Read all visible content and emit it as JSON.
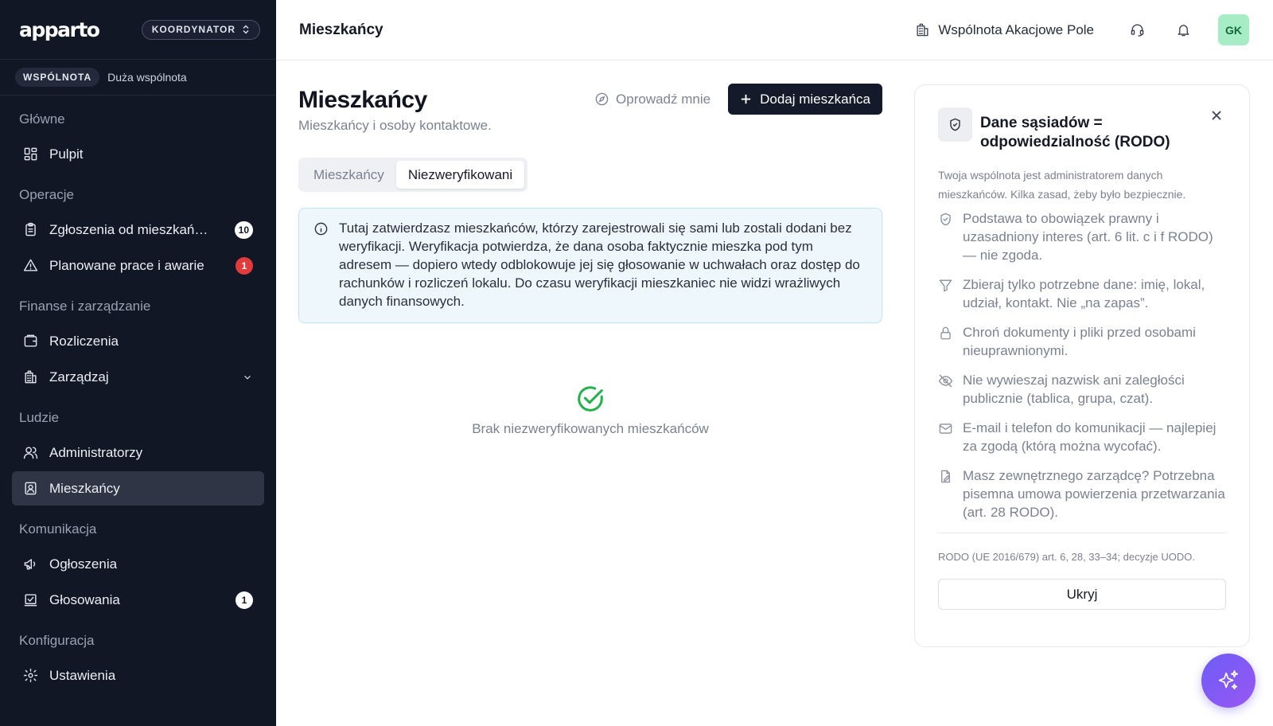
{
  "app": {
    "logo": "apparto",
    "role": "KOORDYNATOR",
    "community_badge": "WSPÓLNOTA",
    "community_size": "Duża wspólnota"
  },
  "sidebar": {
    "sections": [
      {
        "title": "Główne",
        "items": [
          {
            "label": "Pulpit",
            "icon": "dashboard-icon"
          }
        ]
      },
      {
        "title": "Operacje",
        "items": [
          {
            "label": "Zgłoszenia od mieszkań…",
            "icon": "clipboard-icon",
            "badge": "10"
          },
          {
            "label": "Planowane prace i awarie",
            "icon": "warning-icon",
            "badge": "1"
          }
        ]
      },
      {
        "title": "Finanse i zarządzanie",
        "items": [
          {
            "label": "Rozliczenia",
            "icon": "wallet-icon"
          },
          {
            "label": "Zarządzaj",
            "icon": "building-icon"
          }
        ]
      },
      {
        "title": "Ludzie",
        "items": [
          {
            "label": "Administratorzy",
            "icon": "users-icon"
          },
          {
            "label": "Mieszkańcy",
            "icon": "contact-icon"
          }
        ]
      },
      {
        "title": "Komunikacja",
        "items": [
          {
            "label": "Ogłoszenia",
            "icon": "megaphone-icon"
          },
          {
            "label": "Głosowania",
            "icon": "vote-icon",
            "badge": "1"
          }
        ]
      },
      {
        "title": "Konfiguracja",
        "items": [
          {
            "label": "Ustawienia",
            "icon": "gear-icon"
          }
        ]
      }
    ]
  },
  "topbar": {
    "title": "Mieszkańcy",
    "community": "Wspólnota Akacjowe Pole",
    "avatar_initials": "GK"
  },
  "main": {
    "title": "Mieszkańcy",
    "subtitle": "Mieszkańcy i osoby kontaktowe.",
    "tour_label": "Oprowadź mnie",
    "add_label": "Dodaj mieszkańca",
    "tabs": [
      "Mieszkańcy",
      "Niezweryfikowani"
    ],
    "active_tab": "Niezweryfikowani",
    "info": "Tutaj zatwierdzasz mieszkańców, którzy zarejestrowali się sami lub zostali dodani bez weryfikacji. Weryfikacja potwierdza, że dana osoba faktycznie mieszka pod tym adresem — dopiero wtedy odblokowuje jej się głosowanie w uchwałach oraz dostęp do rachunków i rozliczeń lokalu. Do czasu weryfikacji mieszkaniec nie widzi wrażliwych danych finansowych.",
    "empty_text": "Brak niezweryfikowanych mieszkańców"
  },
  "rodo": {
    "title": "Dane sąsiadów = odpowiedzialność (RODO)",
    "intro": "Twoja wspólnota jest administratorem danych mieszkańców. Kilka zasad, żeby było bezpiecznie.",
    "items": [
      {
        "text": "Podstawa to obowiązek prawny i uzasadniony interes (art. 6 lit. c i f RODO) — nie zgoda.",
        "icon": "shield-check-icon"
      },
      {
        "text": "Zbieraj tylko potrzebne dane: imię, lokal, udział, kontakt. Nie „na zapas”.",
        "icon": "filter-icon"
      },
      {
        "text": "Chroń dokumenty i pliki przed osobami nieuprawnionymi.",
        "icon": "lock-icon"
      },
      {
        "text": "Nie wywieszaj nazwisk ani zaległości publicznie (tablica, grupa, czat).",
        "icon": "eye-off-icon"
      },
      {
        "text": "E-mail i telefon do komunikacji — najlepiej za zgodą (którą można wycofać).",
        "icon": "mail-icon"
      },
      {
        "text": "Masz zewnętrznego zarządcę? Potrzebna pisemna umowa powierzenia przetwarzania (art. 28 RODO).",
        "icon": "document-sign-icon"
      }
    ],
    "footer": "RODO (UE 2016/679) art. 6, 28, 33–34; decyzje UODO.",
    "hide_label": "Ukryj"
  }
}
